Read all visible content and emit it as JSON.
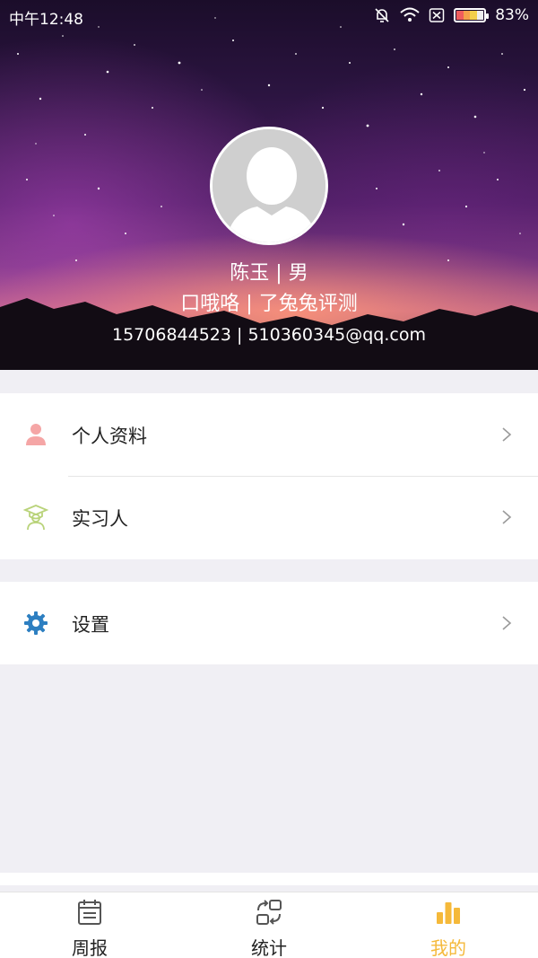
{
  "status_bar": {
    "time": "中午12:48",
    "battery_percent": "83%",
    "icons": [
      "mute-alarm-icon",
      "wifi-icon",
      "sim-x-icon",
      "battery-icon"
    ]
  },
  "profile": {
    "name_gender": "陈玉 | 男",
    "tags": "口哦咯 | 了兔兔评测",
    "contact": "15706844523 | 510360345@qq.com",
    "avatar_icon": "default-avatar-icon"
  },
  "menu": {
    "group1": [
      {
        "label": "个人资料",
        "icon": "person-icon",
        "color": "#f5a6a6"
      },
      {
        "label": "实习人",
        "icon": "graduate-icon",
        "color": "#b9d37a"
      }
    ],
    "group2": [
      {
        "label": "设置",
        "icon": "gear-icon",
        "color": "#2d7fc1"
      }
    ]
  },
  "tabs": [
    {
      "label": "周报",
      "icon": "calendar-icon",
      "active": false
    },
    {
      "label": "统计",
      "icon": "swap-icon",
      "active": false
    },
    {
      "label": "我的",
      "icon": "bar-chart-icon",
      "active": true
    }
  ],
  "colors": {
    "accent": "#f5b93a",
    "background": "#f0eff4"
  }
}
